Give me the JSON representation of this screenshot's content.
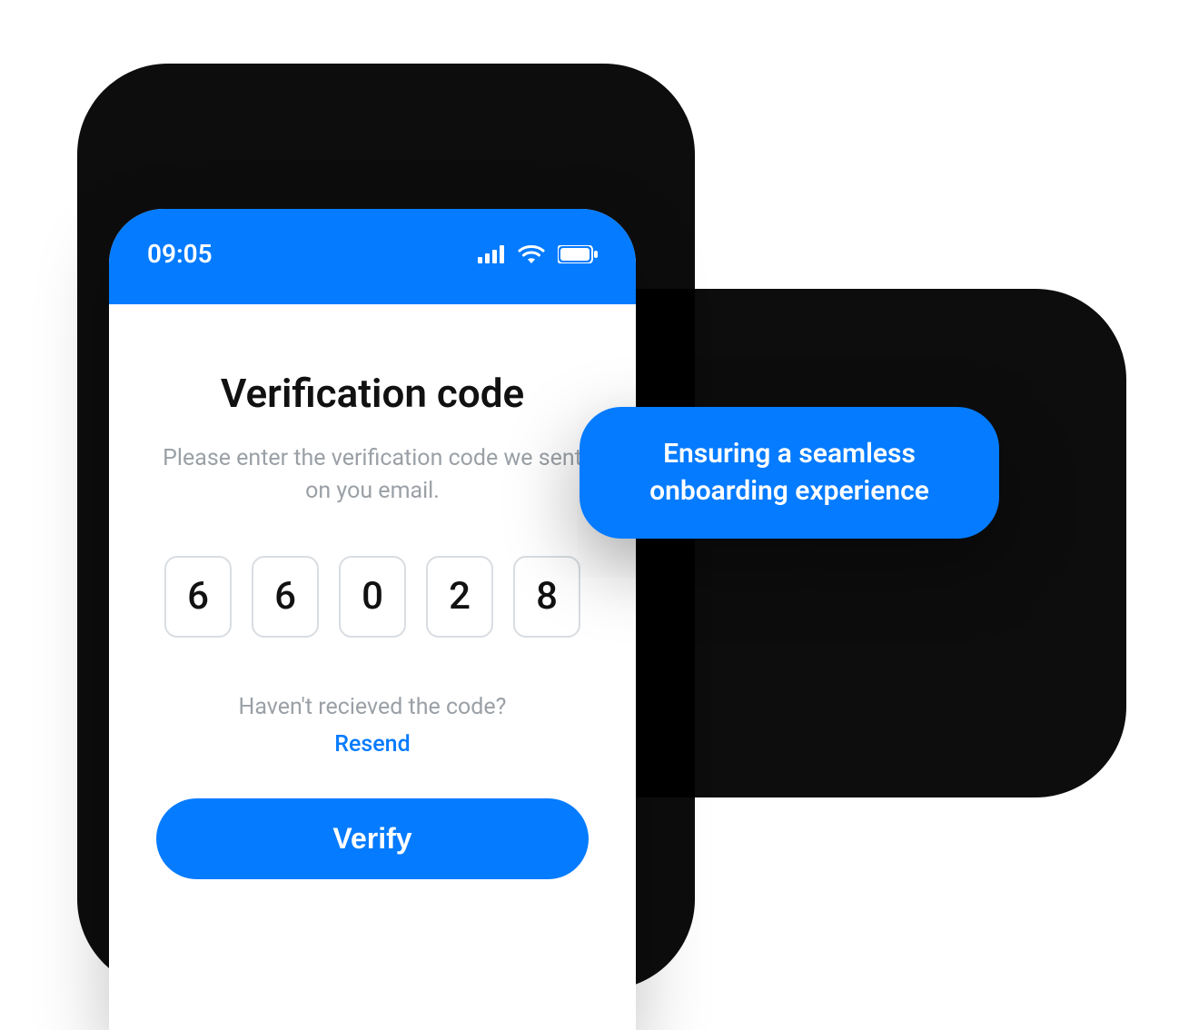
{
  "colors": {
    "accent": "#057bff",
    "text": "#111111",
    "muted": "#9aa0a6",
    "box_border": "#d9dde1"
  },
  "status_bar": {
    "time": "09:05",
    "icons": [
      "signal-icon",
      "wifi-icon",
      "battery-icon"
    ]
  },
  "verification": {
    "title": "Verification code",
    "subtitle": "Please enter the verification code we sent on you email.",
    "code_digits": [
      "6",
      "6",
      "0",
      "2",
      "8"
    ],
    "resend_question": "Haven't recieved the code?",
    "resend_label": "Resend",
    "verify_label": "Verify"
  },
  "callout": {
    "text": "Ensuring a seamless onboarding experience"
  }
}
